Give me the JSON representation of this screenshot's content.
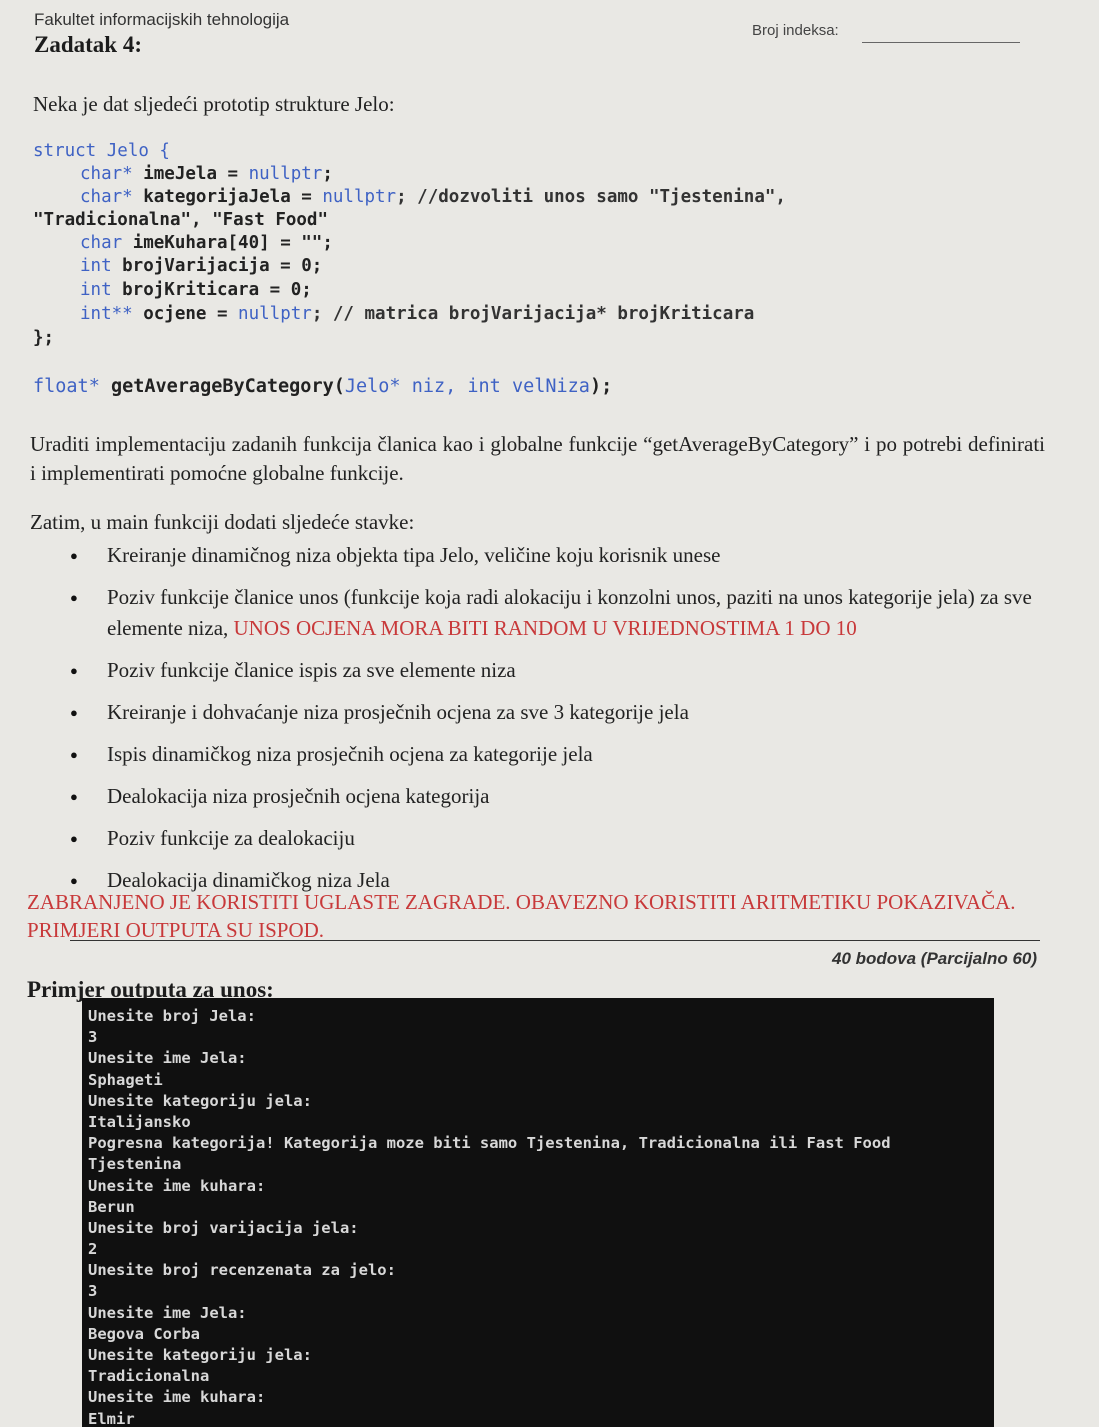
{
  "header": {
    "faculty": "Fakultet informacijskih tehnologija",
    "task_title": "Zadatak 4:",
    "index_label": "Broj indeksa:"
  },
  "intro": "Neka je dat sljedeći prototip strukture Jelo:",
  "struct": {
    "open_kw": "struct",
    "open_rest": " Jelo {",
    "f1_kw": "char*",
    "f1_rest": " imeJela = ",
    "f1_null": "nullptr",
    "f1_end": ";",
    "f2_kw": "char*",
    "f2_rest": " kategorijaJela = ",
    "f2_null": "nullptr",
    "f2_end": "; //dozvoliti unos samo \"Tjestenina\",",
    "f2_cont": "\"Tradicionalna\", \"Fast Food\"",
    "f3_kw": "char",
    "f3_rest": " imeKuhara[40] = \"\";",
    "f4_kw": "int",
    "f4_rest": " brojVarijacija = 0;",
    "f5_kw": "int",
    "f5_rest": " brojKriticara = 0;",
    "f6_kw": "int**",
    "f6_rest": " ocjene = ",
    "f6_null": "nullptr",
    "f6_end": "; // matrica brojVarijacija* brojKriticara",
    "close": "};"
  },
  "function_proto": {
    "ret_kw": "float*",
    "name": " getAverageByCategory(",
    "p1_type": "Jelo*",
    "p1_name": " niz, ",
    "p2_type": "int",
    "p2_name": " velNiza",
    "end": ");"
  },
  "requirement": "Uraditi implementaciju zadanih funkcija članica kao i globalne funkcije “getAverageByCategory” i po potrebi definirati i implementirati pomoćne globalne funkcije.",
  "main_intro": "Zatim, u main funkciji dodati sljedeće stavke:",
  "tasks": [
    "Kreiranje dinamičnog niza objekta tipa Jelo, veličine koju korisnik unese",
    "Poziv funkcije članice unos (funkcije koja radi alokaciju i konzolni unos, paziti na unos kategorije jela) za sve elemente niza, ",
    "Poziv funkcije članice ispis za sve elemente niza",
    "Kreiranje i dohvaćanje niza prosječnih ocjena za sve 3 kategorije jela",
    "Ispis dinamičkog niza prosječnih ocjena za kategorije jela",
    "Dealokacija niza prosječnih ocjena kategorija",
    "Poziv funkcije za dealokaciju",
    "Dealokacija dinamičkog niza Jela"
  ],
  "task2_red": "UNOS OCJENA MORA BITI RANDOM U VRIJEDNOSTIMA 1 DO 10",
  "warning": "ZABRANJENO JE KORISTITI UGLASTE ZAGRADE. OBAVEZNO KORISTITI ARITMETIKU POKAZIVAČA. PRIMJERI OUTPUTA SU ISPOD.",
  "points": "40 bodova (Parcijalno 60)",
  "example_title": "Primjer outputa za unos:",
  "console_lines": [
    "Unesite broj Jela:",
    "3",
    "Unesite ime Jela:",
    "Sphageti",
    "Unesite kategoriju jela:",
    "Italijansko",
    "Pogresna kategorija! Kategorija moze biti samo Tjestenina, Tradicionalna ili Fast Food",
    "Tjestenina",
    "Unesite ime kuhara:",
    "Berun",
    "Unesite broj varijacija jela:",
    "2",
    "Unesite broj recenzenata za jelo:",
    "3",
    "Unesite ime Jela:",
    "Begova Corba",
    "Unesite kategoriju jela:",
    "Tradicionalna",
    "Unesite ime kuhara:",
    "Elmir"
  ],
  "colors": {
    "paper": "#e9e8e4",
    "keyword_blue": "#3f62c4",
    "warning_red": "#c8393a",
    "console_bg": "#101010",
    "console_text": "#d8d8d8"
  }
}
